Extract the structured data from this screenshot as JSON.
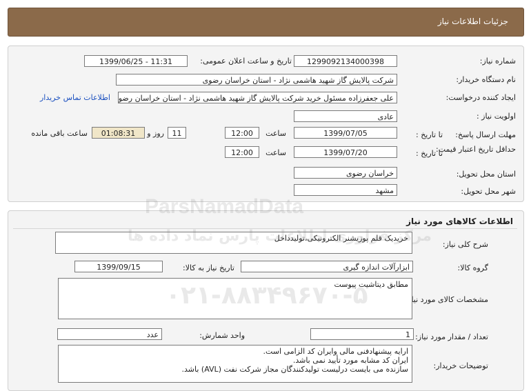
{
  "header": {
    "title": "جزئیات اطلاعات نیاز"
  },
  "need_info": {
    "need_number_label": "شماره نیاز:",
    "need_number": "1299092134000398",
    "announce_label": "تاریخ و ساعت اعلان عمومی:",
    "announce_value": "1399/06/25 - 11:31",
    "buyer_org_label": "نام دستگاه خریدار:",
    "buyer_org": "شرکت پالایش گاز شهید هاشمی نژاد - استان خراسان رضوی",
    "requester_label": "ایجاد کننده درخواست:",
    "requester": "علی جعفرزاده مسئول خرید شرکت پالایش گاز شهید هاشمی نژاد - استان خراسان رضوی",
    "contact_link": "اطلاعات تماس خریدار",
    "priority_label": "اولویت نیاز :",
    "priority": "عادی",
    "deadline_label": "مهلت ارسال پاسخ:",
    "to_date_label": "تا تاریخ :",
    "deadline_date": "1399/07/05",
    "time_label": "ساعت",
    "deadline_time": "12:00",
    "days_value": "11",
    "days_label": "روز و",
    "remaining_time": "01:08:31",
    "remaining_label": "ساعت باقی مانده",
    "validity_label": "حداقل تاریخ اعتبار قیمت:",
    "validity_date": "1399/07/20",
    "validity_time": "12:00",
    "province_label": "استان محل تحویل:",
    "province": "خراسان رضوی",
    "city_label": "شهر محل تحویل:",
    "city": "مشهد"
  },
  "goods": {
    "section_title": "اطلاعات کالاهای مورد نیاز",
    "description_label": "شرح کلی نیاز:",
    "description": "خریدیک قلم پوزیشنر الکترونیکی،تولیدداخل",
    "group_label": "گروه کالا:",
    "group": "ابزارآلات اندازه گیری",
    "need_date_label": "تاریخ نیاز به کالا:",
    "need_date": "1399/09/15",
    "specs_label": "مشخصات کالای مورد نیاز:",
    "specs": "مطابق دیتاشیت پیوست",
    "unit_label": "واحد شمارش:",
    "unit": "عدد",
    "quantity_label": "تعداد / مقدار مورد نیاز:",
    "quantity": "1",
    "buyer_notes_label": "توضیحات خریدار:",
    "buyer_notes": [
      "ارایه پیشنهادفنی مالی وایران کد الزامی است.",
      "ایران کد مشابه مورد تأیید نمی باشد.",
      "سازنده می بایست درلیست تولیدکنندگان مجاز شرکت نفت (AVL)  باشد."
    ]
  },
  "watermark": {
    "brand": "ParsNamadData",
    "persian": "مرکز فراوری اطلاعات پارس نماد داده ها",
    "phone": "۰۲۱-۸۸۳۴۹۶۷۰-۵"
  }
}
